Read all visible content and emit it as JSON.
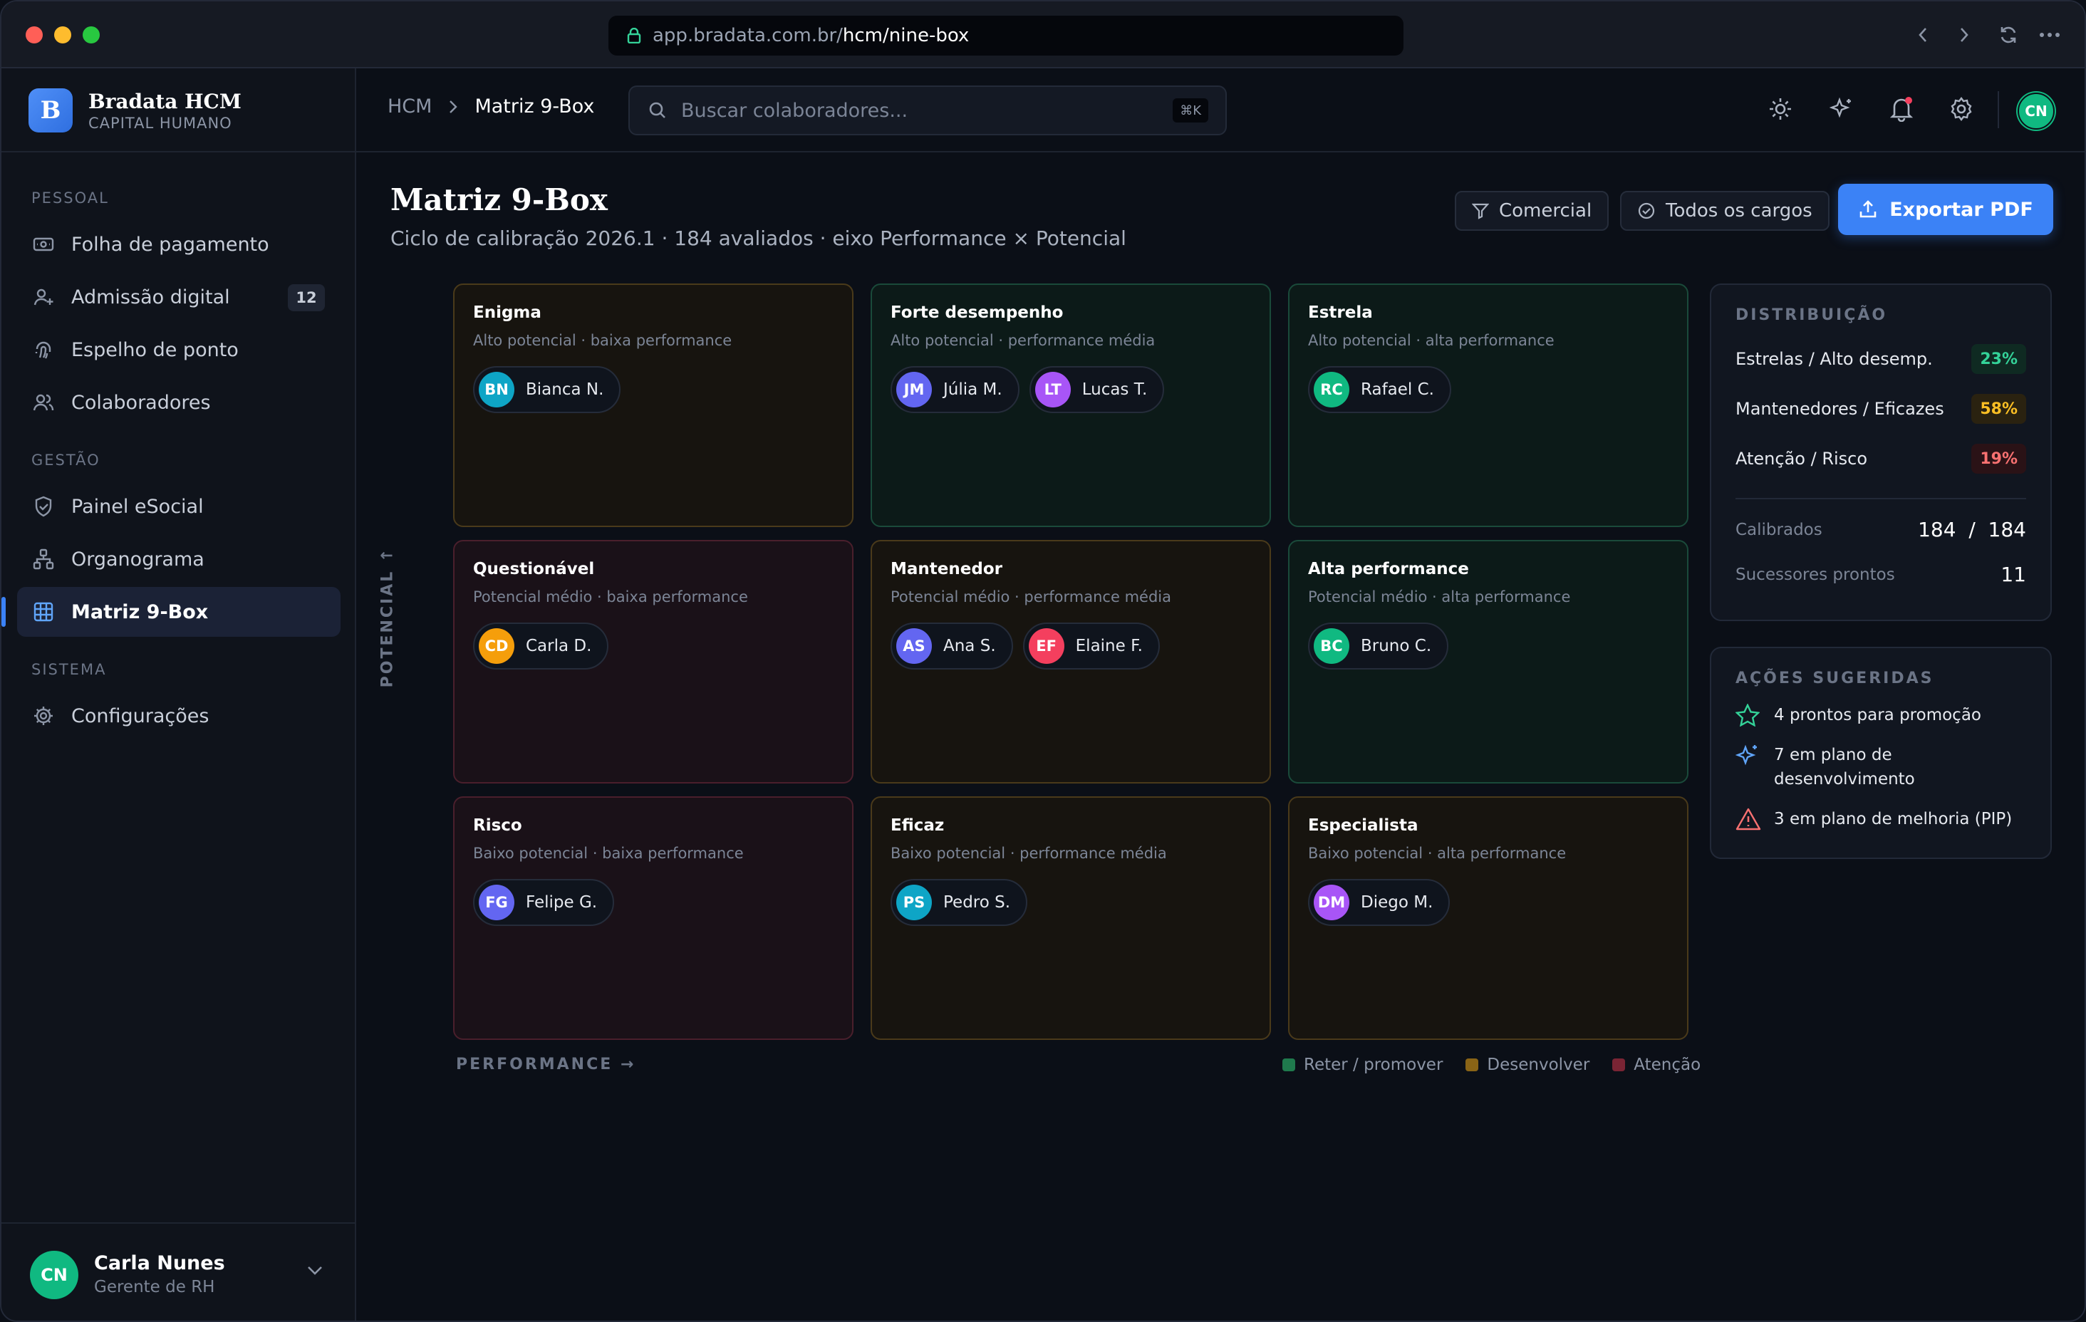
{
  "browser": {
    "url_host": "app.bradata.com.br/",
    "url_path": "hcm/nine-box"
  },
  "brand": {
    "name": "Bradata HCM",
    "tagline": "CAPITAL HUMANO",
    "logo": "B"
  },
  "sidebar": {
    "sections": [
      {
        "label": "PESSOAL",
        "items": [
          {
            "label": "Folha de pagamento",
            "icon": "payroll-icon"
          },
          {
            "label": "Admissão digital",
            "icon": "user-plus-icon",
            "badge": "12"
          },
          {
            "label": "Espelho de ponto",
            "icon": "fingerprint-icon"
          },
          {
            "label": "Colaboradores",
            "icon": "users-icon"
          }
        ]
      },
      {
        "label": "GESTÃO",
        "items": [
          {
            "label": "Painel eSocial",
            "icon": "shield-icon"
          },
          {
            "label": "Organograma",
            "icon": "org-chart-icon"
          },
          {
            "label": "Matriz 9-Box",
            "icon": "grid-icon",
            "active": true
          }
        ]
      },
      {
        "label": "SISTEMA",
        "items": [
          {
            "label": "Configurações",
            "icon": "gear-icon"
          }
        ]
      }
    ],
    "user": {
      "initials": "CN",
      "name": "Carla Nunes",
      "role": "Gerente de RH"
    }
  },
  "topbar": {
    "breadcrumb": [
      "HCM",
      "Matriz 9-Box"
    ],
    "search_placeholder": "Buscar colaboradores...",
    "search_shortcut": "⌘K",
    "user_initials": "CN"
  },
  "page": {
    "title": "Matriz 9-Box",
    "subtitle": "Ciclo de calibração 2026.1 · 184 avaliados · eixo Performance × Potencial",
    "filters": [
      "Comercial",
      "Todos os cargos"
    ],
    "export_label": "Exportar PDF"
  },
  "matrix": {
    "y_axis": "POTENCIAL ↑",
    "x_axis": "PERFORMANCE →",
    "cells": [
      {
        "title": "Enigma",
        "desc": "Alto potencial · baixa performance",
        "tone": "amber",
        "people": [
          {
            "i": "BN",
            "n": "Bianca N.",
            "c": "#0ea5c6"
          }
        ]
      },
      {
        "title": "Forte desempenho",
        "desc": "Alto potencial · performance média",
        "tone": "green",
        "people": [
          {
            "i": "JM",
            "n": "Júlia M.",
            "c": "#6366f1"
          },
          {
            "i": "LT",
            "n": "Lucas T.",
            "c": "#a855f7"
          }
        ]
      },
      {
        "title": "Estrela",
        "desc": "Alto potencial · alta performance",
        "tone": "green",
        "people": [
          {
            "i": "RC",
            "n": "Rafael C.",
            "c": "#10b981"
          }
        ]
      },
      {
        "title": "Questionável",
        "desc": "Potencial médio · baixa performance",
        "tone": "red",
        "people": [
          {
            "i": "CD",
            "n": "Carla D.",
            "c": "#f59e0b"
          }
        ]
      },
      {
        "title": "Mantenedor",
        "desc": "Potencial médio · performance média",
        "tone": "amber",
        "people": [
          {
            "i": "AS",
            "n": "Ana S.",
            "c": "#6366f1"
          },
          {
            "i": "EF",
            "n": "Elaine F.",
            "c": "#f43f5e"
          }
        ]
      },
      {
        "title": "Alta performance",
        "desc": "Potencial médio · alta performance",
        "tone": "green",
        "people": [
          {
            "i": "BC",
            "n": "Bruno C.",
            "c": "#10b981"
          }
        ]
      },
      {
        "title": "Risco",
        "desc": "Baixo potencial · baixa performance",
        "tone": "red",
        "people": [
          {
            "i": "FG",
            "n": "Felipe G.",
            "c": "#6366f1"
          }
        ]
      },
      {
        "title": "Eficaz",
        "desc": "Baixo potencial · performance média",
        "tone": "amber",
        "people": [
          {
            "i": "PS",
            "n": "Pedro S.",
            "c": "#0ea5c6"
          }
        ]
      },
      {
        "title": "Especialista",
        "desc": "Baixo potencial · alta performance",
        "tone": "amber",
        "people": [
          {
            "i": "DM",
            "n": "Diego M.",
            "c": "#a855f7"
          }
        ]
      }
    ],
    "legend": [
      {
        "label": "Reter / promover",
        "color": "#1f7a4d"
      },
      {
        "label": "Desenvolver",
        "color": "#8a6416"
      },
      {
        "label": "Atenção",
        "color": "#7a2434"
      }
    ]
  },
  "distribution": {
    "title": "DISTRIBUIÇÃO",
    "rows": [
      {
        "label": "Estrelas / Alto desemp.",
        "value": "23%",
        "fg": "#34d399",
        "bg": "#0f2a22"
      },
      {
        "label": "Mantenedores / Eficazes",
        "value": "58%",
        "fg": "#fbbf24",
        "bg": "#2a2210"
      },
      {
        "label": "Atenção / Risco",
        "value": "19%",
        "fg": "#f87171",
        "bg": "#2a1216"
      }
    ],
    "calibrated_label": "Calibrados",
    "calibrated_value": "184  /  184",
    "successors_label": "Sucessores prontos",
    "successors_value": "11"
  },
  "actions": {
    "title": "AÇÕES SUGERIDAS",
    "items": [
      {
        "label": "4 prontos para promoção",
        "icon": "star-icon"
      },
      {
        "label": "7 em plano de desenvolvimento",
        "icon": "sparkle-icon"
      },
      {
        "label": "3 em plano de melhoria (PIP)",
        "icon": "warning-icon"
      }
    ]
  }
}
